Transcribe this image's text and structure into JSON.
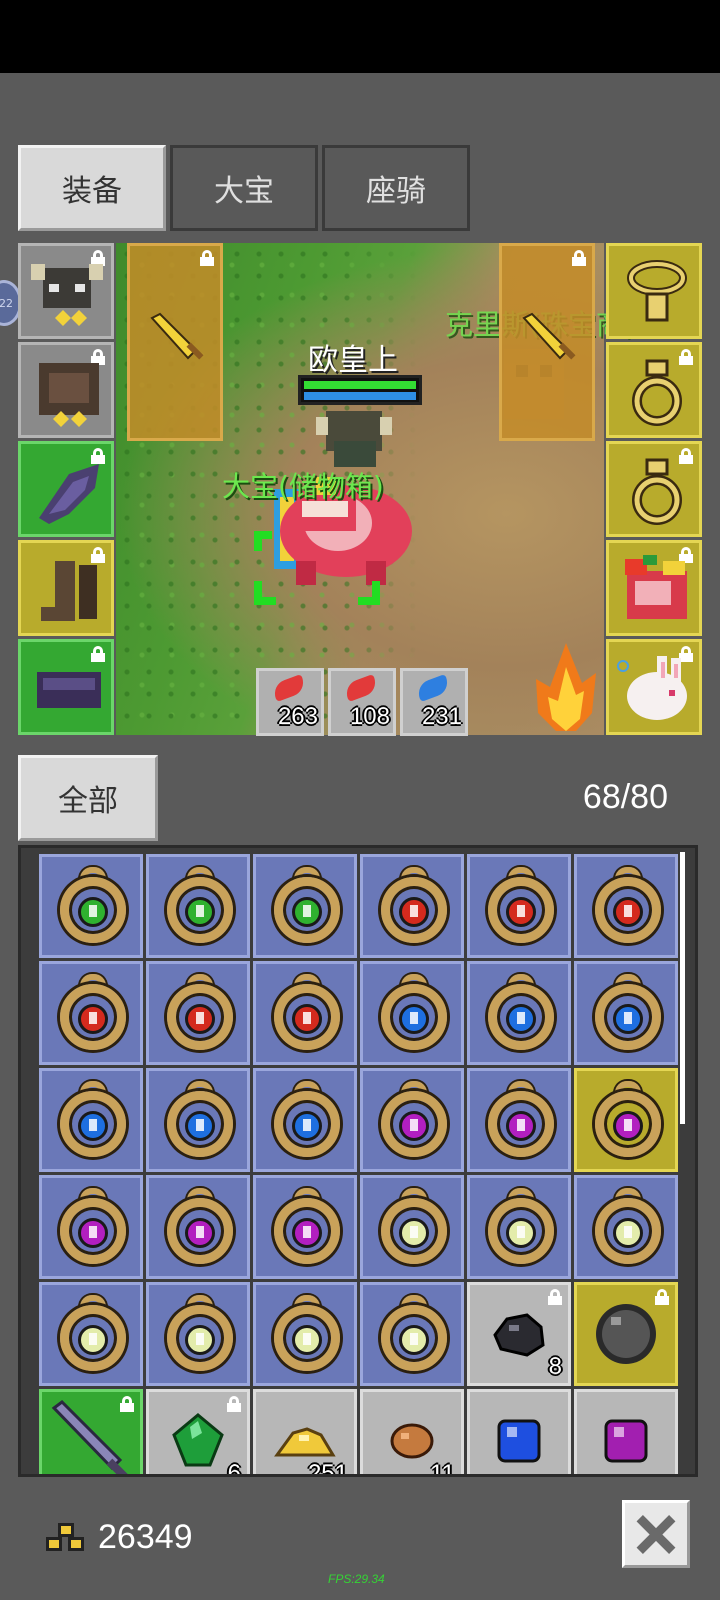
{
  "tabs": [
    {
      "label": "装备",
      "active": true
    },
    {
      "label": "大宝",
      "active": false
    },
    {
      "label": "座骑",
      "active": false
    }
  ],
  "side_bubble": "22",
  "scene": {
    "player_name": "欧皇上",
    "pet_label": "大宝(储物箱)",
    "npc_label": "克里斯(珠宝商)",
    "stats": [
      "263",
      "108",
      "231"
    ]
  },
  "inventory": {
    "filter_label": "全部",
    "capacity": "68/80",
    "items": [
      {
        "kind": "rune",
        "gem": "#2fb12f",
        "bg": "blue"
      },
      {
        "kind": "rune",
        "gem": "#2fb12f",
        "bg": "blue"
      },
      {
        "kind": "rune",
        "gem": "#2fb12f",
        "bg": "blue"
      },
      {
        "kind": "rune",
        "gem": "#d42a1e",
        "bg": "blue"
      },
      {
        "kind": "rune",
        "gem": "#d42a1e",
        "bg": "blue"
      },
      {
        "kind": "rune",
        "gem": "#d42a1e",
        "bg": "blue"
      },
      {
        "kind": "rune",
        "gem": "#d42a1e",
        "bg": "blue"
      },
      {
        "kind": "rune",
        "gem": "#d42a1e",
        "bg": "blue"
      },
      {
        "kind": "rune",
        "gem": "#d42a1e",
        "bg": "blue"
      },
      {
        "kind": "rune",
        "gem": "#1e6fe0",
        "bg": "blue"
      },
      {
        "kind": "rune",
        "gem": "#1e6fe0",
        "bg": "blue"
      },
      {
        "kind": "rune",
        "gem": "#1e6fe0",
        "bg": "blue"
      },
      {
        "kind": "rune",
        "gem": "#1e6fe0",
        "bg": "blue"
      },
      {
        "kind": "rune",
        "gem": "#1e6fe0",
        "bg": "blue"
      },
      {
        "kind": "rune",
        "gem": "#1e6fe0",
        "bg": "blue"
      },
      {
        "kind": "rune",
        "gem": "#b21fc0",
        "bg": "blue"
      },
      {
        "kind": "rune",
        "gem": "#b21fc0",
        "bg": "blue"
      },
      {
        "kind": "rune",
        "gem": "#b21fc0",
        "bg": "gold"
      },
      {
        "kind": "rune",
        "gem": "#b21fc0",
        "bg": "blue"
      },
      {
        "kind": "rune",
        "gem": "#b21fc0",
        "bg": "blue"
      },
      {
        "kind": "rune",
        "gem": "#b21fc0",
        "bg": "blue"
      },
      {
        "kind": "rune",
        "gem": "#e3ecab",
        "bg": "blue"
      },
      {
        "kind": "rune",
        "gem": "#e3ecab",
        "bg": "blue"
      },
      {
        "kind": "rune",
        "gem": "#e3ecab",
        "bg": "blue"
      },
      {
        "kind": "rune",
        "gem": "#e3ecab",
        "bg": "blue"
      },
      {
        "kind": "rune",
        "gem": "#e3ecab",
        "bg": "blue"
      },
      {
        "kind": "rune",
        "gem": "#e3ecab",
        "bg": "blue"
      },
      {
        "kind": "rune",
        "gem": "#e3ecab",
        "bg": "blue"
      },
      {
        "kind": "stone",
        "color": "#2a2a30",
        "bg": "light",
        "count": "8",
        "locked": true
      },
      {
        "kind": "orb",
        "color": "#555555",
        "bg": "gold",
        "locked": true
      },
      {
        "kind": "sword",
        "color": "#8a86b8",
        "bg": "green",
        "locked": true
      },
      {
        "kind": "emerald",
        "color": "#1e9e3a",
        "bg": "light",
        "count": "6",
        "locked": true
      },
      {
        "kind": "goldpile",
        "color": "#f0c93a",
        "bg": "light",
        "count": "251"
      },
      {
        "kind": "ore",
        "color": "#c57a3e",
        "bg": "light",
        "count": "11"
      },
      {
        "kind": "cube",
        "color": "#1e4fe0",
        "bg": "light"
      },
      {
        "kind": "cube",
        "color": "#a21fb0",
        "bg": "light"
      }
    ]
  },
  "footer": {
    "gold": "26349",
    "fps": "FPS:29.34"
  },
  "colors": {
    "slot_blue": "#6a78b8",
    "slot_gold": "#b8ab2c",
    "slot_green": "#34a832",
    "slot_gray": "#8a8a8a"
  }
}
